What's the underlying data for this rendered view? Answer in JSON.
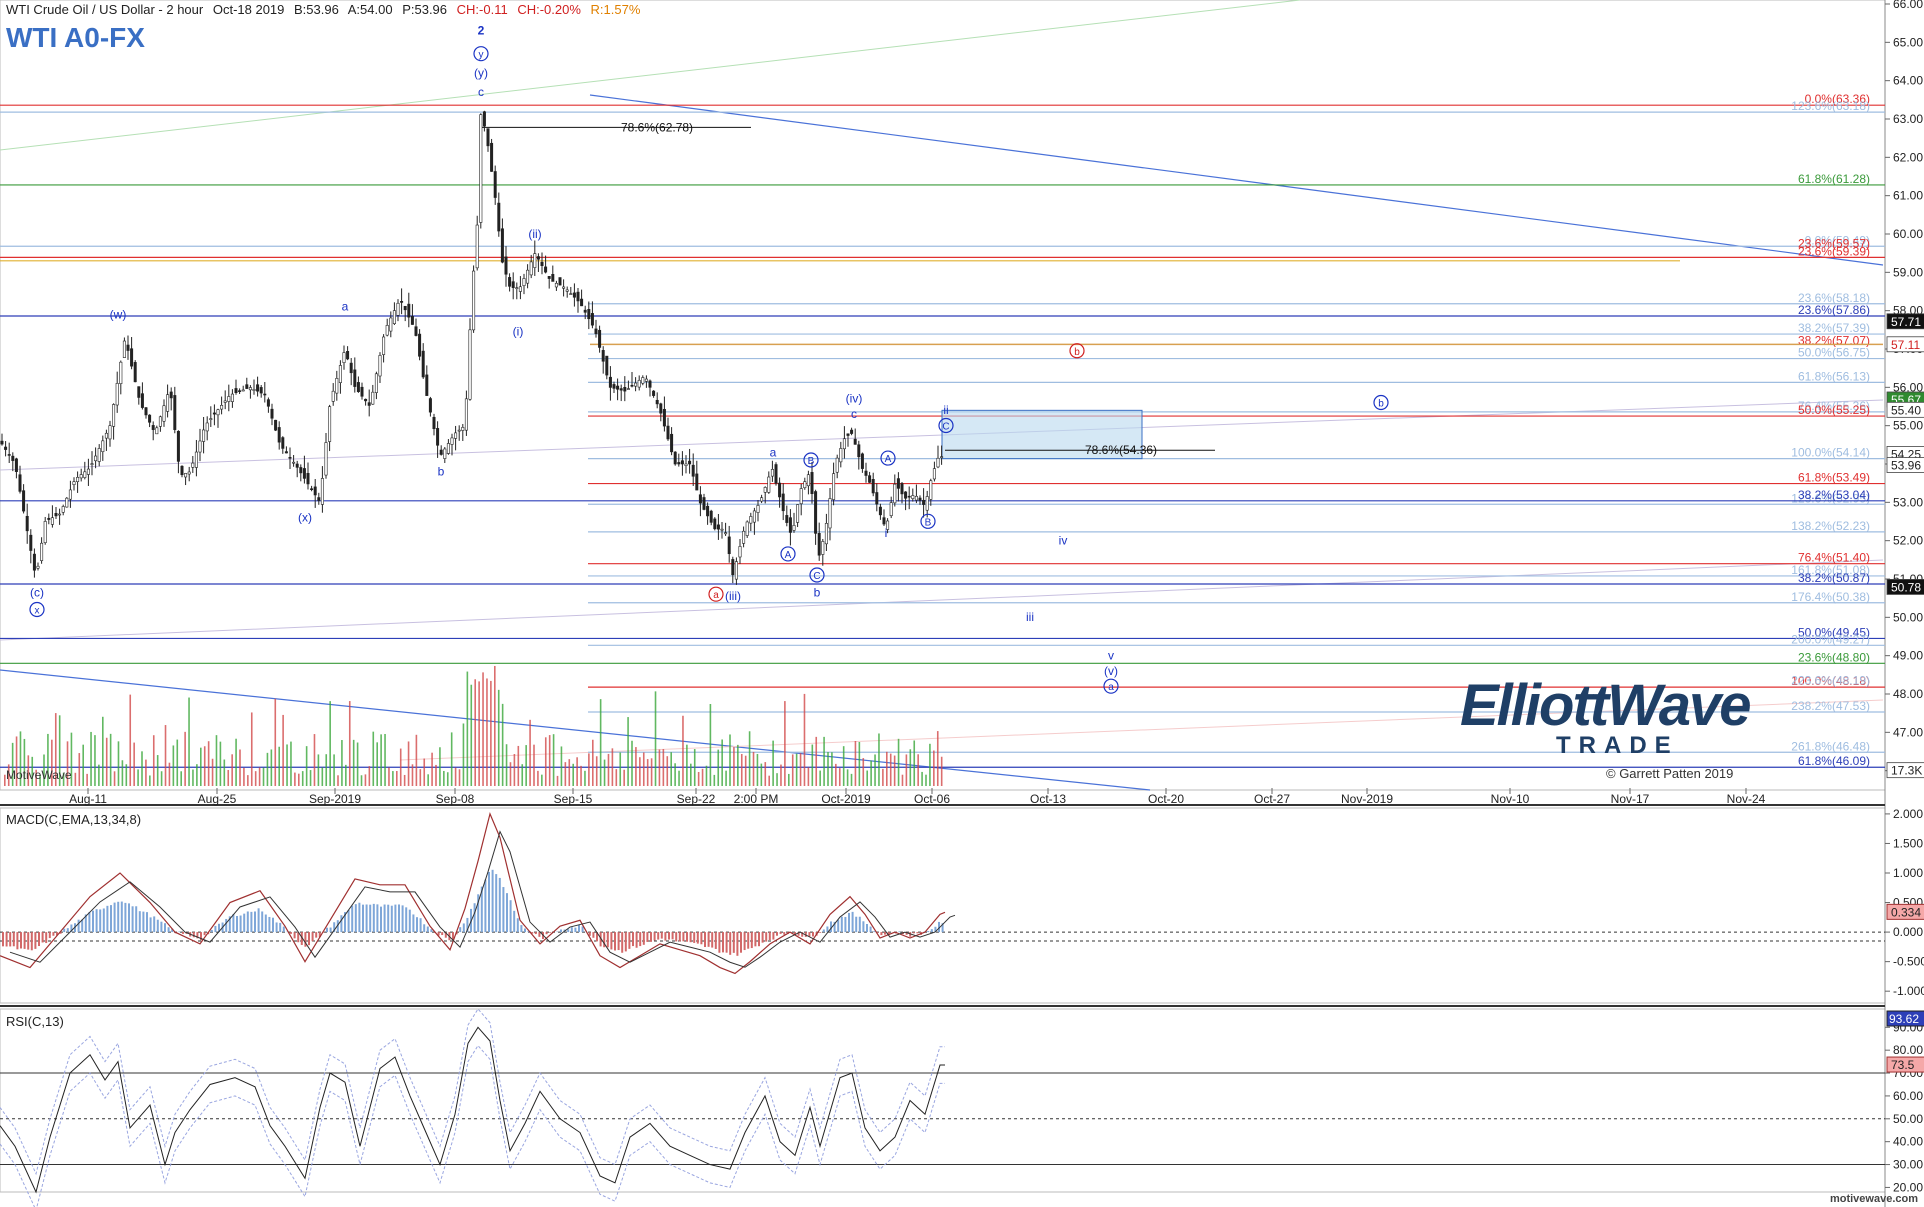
{
  "header": {
    "title": "WTI Crude Oil / US Dollar - 2 hour",
    "date": "Oct-18 2019",
    "bid": "B:53.96",
    "ask": "A:54.00",
    "price": "P:53.96",
    "change": "CH:-0.11",
    "change_pct": "CH:-0.20%",
    "range": "R:1.57%"
  },
  "symbol": "WTI A0-FX",
  "watermark": "MotiveWave",
  "credit": "© Garrett Patten 2019",
  "logo": {
    "top": "ElliottWave",
    "bottom": "TRADE"
  },
  "brand": "motivewave.com",
  "colors": {
    "bull": "#3aa63a",
    "bear": "#d24a4a",
    "fib_red": "#e03030",
    "fib_green": "#3a9a3a",
    "fib_blue": "#2d3fb8",
    "fib_light": "#9fbde0",
    "label_blue": "#1a33c4",
    "label_red": "#d02020",
    "zone": "#b9d9ee"
  },
  "chart_data": [
    {
      "type": "candlestick",
      "pane": "price",
      "ylim": [
        45.6,
        66.0
      ],
      "y_ticks": [
        "46.00",
        "47.00",
        "48.00",
        "49.00",
        "50.00",
        "51.00",
        "52.00",
        "53.00",
        "54.00",
        "55.00",
        "56.00",
        "57.00",
        "58.00",
        "59.00",
        "60.00",
        "61.00",
        "62.00",
        "63.00",
        "64.00",
        "65.00",
        "66.00"
      ],
      "x_ticks": [
        "Aug-11",
        "Aug-25",
        "Sep-2019",
        "Sep-08",
        "Sep-15",
        "Sep-22",
        "2:00 PM",
        "Oct-2019",
        "Oct-06",
        "Oct-13",
        "Oct-20",
        "Oct-27",
        "Nov-2019",
        "Nov-10",
        "Nov-17",
        "Nov-24"
      ],
      "price_path": [
        [
          0,
          54.6
        ],
        [
          15,
          54.0
        ],
        [
          36,
          51.0
        ],
        [
          45,
          52.5
        ],
        [
          60,
          52.7
        ],
        [
          75,
          53.6
        ],
        [
          90,
          53.9
        ],
        [
          110,
          55.0
        ],
        [
          125,
          57.3
        ],
        [
          140,
          55.6
        ],
        [
          155,
          54.8
        ],
        [
          170,
          56.0
        ],
        [
          180,
          53.7
        ],
        [
          190,
          53.8
        ],
        [
          205,
          55.0
        ],
        [
          230,
          55.8
        ],
        [
          250,
          56.0
        ],
        [
          265,
          55.8
        ],
        [
          280,
          54.5
        ],
        [
          295,
          54.0
        ],
        [
          305,
          53.6
        ],
        [
          320,
          53.0
        ],
        [
          330,
          55.6
        ],
        [
          345,
          57.0
        ],
        [
          355,
          56.0
        ],
        [
          370,
          55.5
        ],
        [
          385,
          57.5
        ],
        [
          400,
          58.3
        ],
        [
          415,
          57.5
        ],
        [
          425,
          56.0
        ],
        [
          440,
          54.2
        ],
        [
          455,
          54.8
        ],
        [
          465,
          55.0
        ],
        [
          472,
          58.5
        ],
        [
          478,
          60.5
        ],
        [
          481,
          63.3
        ],
        [
          488,
          62.3
        ],
        [
          495,
          61.0
        ],
        [
          502,
          59.3
        ],
        [
          510,
          58.6
        ],
        [
          520,
          58.6
        ],
        [
          535,
          59.5
        ],
        [
          550,
          58.8
        ],
        [
          565,
          58.6
        ],
        [
          580,
          58.2
        ],
        [
          595,
          57.5
        ],
        [
          610,
          56.0
        ],
        [
          625,
          55.9
        ],
        [
          645,
          56.3
        ],
        [
          660,
          55.4
        ],
        [
          675,
          54.0
        ],
        [
          690,
          54.0
        ],
        [
          700,
          53.0
        ],
        [
          715,
          52.3
        ],
        [
          725,
          52.3
        ],
        [
          733,
          51.08
        ],
        [
          745,
          52.4
        ],
        [
          760,
          53.0
        ],
        [
          772,
          53.9
        ],
        [
          785,
          52.6
        ],
        [
          792,
          52.1
        ],
        [
          800,
          53.3
        ],
        [
          810,
          53.8
        ],
        [
          818,
          51.5
        ],
        [
          825,
          52.2
        ],
        [
          835,
          54.0
        ],
        [
          845,
          54.7
        ],
        [
          852,
          54.8
        ],
        [
          862,
          53.9
        ],
        [
          870,
          53.5
        ],
        [
          880,
          52.7
        ],
        [
          886,
          52.3
        ],
        [
          895,
          53.5
        ],
        [
          905,
          53.1
        ],
        [
          915,
          53.2
        ],
        [
          925,
          52.9
        ],
        [
          932,
          53.7
        ],
        [
          940,
          54.3
        ],
        [
          945,
          53.96
        ]
      ],
      "volume_bars": 240
    },
    {
      "type": "line",
      "pane": "macd",
      "title": "MACD(C,EMA,13,34,8)",
      "ylim": [
        -1.2,
        2.1
      ],
      "y_ticks": [
        "2.000",
        "1.500",
        "1.000",
        "0.500",
        "0.000",
        "-0.500",
        "-1.000"
      ],
      "last_value": "0.334",
      "macd_path": [
        [
          0,
          -0.4
        ],
        [
          30,
          -0.6
        ],
        [
          60,
          0.0
        ],
        [
          90,
          0.6
        ],
        [
          120,
          1.0
        ],
        [
          150,
          0.5
        ],
        [
          175,
          0.0
        ],
        [
          200,
          -0.2
        ],
        [
          230,
          0.5
        ],
        [
          260,
          0.7
        ],
        [
          285,
          0.1
        ],
        [
          305,
          -0.5
        ],
        [
          330,
          0.2
        ],
        [
          355,
          0.9
        ],
        [
          380,
          0.8
        ],
        [
          405,
          0.8
        ],
        [
          430,
          0.1
        ],
        [
          450,
          -0.3
        ],
        [
          465,
          0.4
        ],
        [
          478,
          1.2
        ],
        [
          490,
          2.0
        ],
        [
          500,
          1.6
        ],
        [
          510,
          0.9
        ],
        [
          520,
          0.2
        ],
        [
          540,
          -0.2
        ],
        [
          560,
          0.1
        ],
        [
          580,
          0.2
        ],
        [
          600,
          -0.4
        ],
        [
          620,
          -0.6
        ],
        [
          640,
          -0.4
        ],
        [
          660,
          -0.2
        ],
        [
          680,
          -0.3
        ],
        [
          700,
          -0.4
        ],
        [
          720,
          -0.6
        ],
        [
          735,
          -0.7
        ],
        [
          750,
          -0.5
        ],
        [
          770,
          -0.2
        ],
        [
          790,
          0.0
        ],
        [
          810,
          -0.2
        ],
        [
          830,
          0.3
        ],
        [
          850,
          0.6
        ],
        [
          865,
          0.3
        ],
        [
          880,
          -0.1
        ],
        [
          895,
          0.0
        ],
        [
          910,
          -0.1
        ],
        [
          925,
          0.0
        ],
        [
          940,
          0.3
        ],
        [
          945,
          0.334
        ]
      ]
    },
    {
      "type": "line",
      "pane": "rsi",
      "title": "RSI(C,13)",
      "ylim": [
        18,
        98
      ],
      "y_ticks": [
        "90.00",
        "80.00",
        "70.00",
        "60.00",
        "50.00",
        "40.00",
        "30.00",
        "20.00"
      ],
      "last_values": [
        "93.62",
        "73.5"
      ],
      "rsi_path": [
        [
          0,
          47
        ],
        [
          15,
          38
        ],
        [
          36,
          18
        ],
        [
          50,
          42
        ],
        [
          70,
          70
        ],
        [
          90,
          78
        ],
        [
          105,
          67
        ],
        [
          118,
          75
        ],
        [
          130,
          46
        ],
        [
          150,
          56
        ],
        [
          165,
          30
        ],
        [
          175,
          44
        ],
        [
          190,
          54
        ],
        [
          210,
          65
        ],
        [
          235,
          68
        ],
        [
          255,
          64
        ],
        [
          270,
          47
        ],
        [
          285,
          38
        ],
        [
          305,
          24
        ],
        [
          320,
          55
        ],
        [
          330,
          70
        ],
        [
          345,
          66
        ],
        [
          360,
          38
        ],
        [
          380,
          72
        ],
        [
          395,
          77
        ],
        [
          410,
          60
        ],
        [
          425,
          45
        ],
        [
          440,
          30
        ],
        [
          455,
          52
        ],
        [
          468,
          83
        ],
        [
          478,
          90
        ],
        [
          490,
          84
        ],
        [
          500,
          58
        ],
        [
          510,
          36
        ],
        [
          525,
          48
        ],
        [
          540,
          62
        ],
        [
          560,
          50
        ],
        [
          580,
          44
        ],
        [
          600,
          25
        ],
        [
          615,
          22
        ],
        [
          630,
          42
        ],
        [
          650,
          48
        ],
        [
          670,
          38
        ],
        [
          690,
          34
        ],
        [
          710,
          30
        ],
        [
          730,
          28
        ],
        [
          745,
          44
        ],
        [
          765,
          60
        ],
        [
          780,
          40
        ],
        [
          795,
          34
        ],
        [
          810,
          55
        ],
        [
          820,
          38
        ],
        [
          840,
          68
        ],
        [
          852,
          70
        ],
        [
          865,
          46
        ],
        [
          880,
          36
        ],
        [
          895,
          42
        ],
        [
          910,
          58
        ],
        [
          925,
          52
        ],
        [
          940,
          73.5
        ],
        [
          945,
          73.5
        ]
      ]
    }
  ],
  "price_axis_labels": [
    {
      "text": "57.71",
      "price": 57.71,
      "style": "dark"
    },
    {
      "text": "57.11",
      "price": 57.11,
      "style": "red"
    },
    {
      "text": "55.67",
      "price": 55.67,
      "style": "green"
    },
    {
      "text": "55.40",
      "price": 55.4,
      "style": "light"
    },
    {
      "text": "54.25",
      "price": 54.25,
      "style": "light"
    },
    {
      "text": "53.96",
      "price": 53.96,
      "style": "light"
    },
    {
      "text": "50.78",
      "price": 50.78,
      "style": "dark"
    },
    {
      "text": "17.3K",
      "price": 46.0,
      "style": "light"
    }
  ],
  "fib_levels": [
    {
      "text": "0.0%(63.36)",
      "price": 63.36,
      "color": "fib_red",
      "line": "full"
    },
    {
      "text": "123.6%(63.18)",
      "price": 63.18,
      "color": "fib_light",
      "line": "full"
    },
    {
      "text": "61.8%(61.28)",
      "price": 61.28,
      "color": "fib_green",
      "line": "full"
    },
    {
      "text": "0.0%(59.49)",
      "price": 59.68,
      "color": "fib_light",
      "line": "full"
    },
    {
      "text": "23.6%(59.57)",
      "price": 59.6,
      "color": "fib_red",
      "line": "none"
    },
    {
      "text": "23.6%(59.39)",
      "price": 59.39,
      "color": "fib_red",
      "line": "full"
    },
    {
      "text": "23.6%(58.18)",
      "price": 58.18,
      "color": "fib_light",
      "line": "short"
    },
    {
      "text": "23.6%(57.86)",
      "price": 57.86,
      "color": "fib_blue",
      "line": "full"
    },
    {
      "text": "38.2%(57.39)",
      "price": 57.39,
      "color": "fib_light",
      "line": "short"
    },
    {
      "text": "38.2%(57.07)",
      "price": 57.07,
      "color": "fib_red",
      "line": "none"
    },
    {
      "text": "50.0%(56.75)",
      "price": 56.75,
      "color": "fib_light",
      "line": "short"
    },
    {
      "text": "61.8%(56.13)",
      "price": 56.13,
      "color": "fib_light",
      "line": "short"
    },
    {
      "text": "76.4%(55.36)",
      "price": 55.36,
      "color": "fib_light",
      "line": "short"
    },
    {
      "text": "50.0%(55.25)",
      "price": 55.25,
      "color": "fib_red",
      "line": "short"
    },
    {
      "text": "100.0%(54.14)",
      "price": 54.14,
      "color": "fib_light",
      "line": "short"
    },
    {
      "text": "61.8%(53.49)",
      "price": 53.49,
      "color": "fib_red",
      "line": "short"
    },
    {
      "text": "123.6%(52.95)",
      "price": 52.95,
      "color": "fib_light",
      "line": "short"
    },
    {
      "text": "38.2%(53.04)",
      "price": 53.04,
      "color": "fib_blue",
      "line": "full"
    },
    {
      "text": "138.2%(52.23)",
      "price": 52.23,
      "color": "fib_light",
      "line": "short"
    },
    {
      "text": "76.4%(51.40)",
      "price": 51.4,
      "color": "fib_red",
      "line": "short"
    },
    {
      "text": "161.8%(51.08)",
      "price": 51.08,
      "color": "fib_light",
      "line": "short"
    },
    {
      "text": "38.2%(50.87)",
      "price": 50.87,
      "color": "fib_blue",
      "line": "full"
    },
    {
      "text": "176.4%(50.38)",
      "price": 50.38,
      "color": "fib_light",
      "line": "short"
    },
    {
      "text": "50.0%(49.45)",
      "price": 49.45,
      "color": "fib_blue",
      "line": "full"
    },
    {
      "text": "200.0%(49.27)",
      "price": 49.27,
      "color": "fib_light",
      "line": "short"
    },
    {
      "text": "23.6%(48.80)",
      "price": 48.8,
      "color": "fib_green",
      "line": "full"
    },
    {
      "text": "100.0%(48.18)",
      "price": 48.18,
      "color": "fib_red",
      "line": "short"
    },
    {
      "text": "223.6%(48.19)",
      "price": 48.19,
      "color": "fib_light",
      "line": "none"
    },
    {
      "text": "238.2%(47.53)",
      "price": 47.53,
      "color": "fib_light",
      "line": "short"
    },
    {
      "text": "261.8%(46.48)",
      "price": 46.48,
      "color": "fib_light",
      "line": "short"
    },
    {
      "text": "61.8%(46.09)",
      "price": 46.09,
      "color": "fib_blue",
      "line": "full"
    }
  ],
  "inline_fibs": [
    {
      "text": "78.6%(62.78)",
      "price": 62.78,
      "x0": 481
    },
    {
      "text": "78.6%(54.36)",
      "price": 54.36,
      "x0": 945
    }
  ],
  "wave_labels": [
    {
      "text": "2",
      "x": 481,
      "price": 65.2,
      "color": "label_blue",
      "bold": true
    },
    {
      "text": "y",
      "x": 481,
      "price": 64.6,
      "color": "label_blue",
      "circle": true
    },
    {
      "text": "(y)",
      "x": 481,
      "price": 64.1,
      "color": "label_blue"
    },
    {
      "text": "c",
      "x": 481,
      "price": 63.6,
      "color": "label_blue"
    },
    {
      "text": "(w)",
      "x": 118,
      "price": 57.8,
      "color": "label_blue"
    },
    {
      "text": "a",
      "x": 345,
      "price": 58.0,
      "color": "label_blue"
    },
    {
      "text": "b",
      "x": 441,
      "price": 53.7,
      "color": "label_blue"
    },
    {
      "text": "(x)",
      "x": 305,
      "price": 52.5,
      "color": "label_blue"
    },
    {
      "text": "(c)",
      "x": 37,
      "price": 50.55,
      "color": "label_blue"
    },
    {
      "text": "x",
      "x": 37,
      "price": 50.1,
      "color": "label_blue",
      "circle": true
    },
    {
      "text": "(ii)",
      "x": 535,
      "price": 59.9,
      "color": "label_blue"
    },
    {
      "text": "(i)",
      "x": 518,
      "price": 57.35,
      "color": "label_blue"
    },
    {
      "text": "(iii)",
      "x": 733,
      "price": 50.45,
      "color": "label_blue"
    },
    {
      "text": "a",
      "x": 716,
      "price": 50.5,
      "color": "label_red",
      "circle": true
    },
    {
      "text": "a",
      "x": 773,
      "price": 54.2,
      "color": "label_blue"
    },
    {
      "text": "A",
      "x": 788,
      "price": 51.55,
      "color": "label_blue",
      "circle": true
    },
    {
      "text": "B",
      "x": 811,
      "price": 54.0,
      "color": "label_blue",
      "circle": true
    },
    {
      "text": "C",
      "x": 817,
      "price": 51.0,
      "color": "label_blue",
      "circle": true
    },
    {
      "text": "b",
      "x": 817,
      "price": 50.55,
      "color": "label_blue"
    },
    {
      "text": "(iv)",
      "x": 854,
      "price": 55.6,
      "color": "label_blue"
    },
    {
      "text": "c",
      "x": 854,
      "price": 55.2,
      "color": "label_blue"
    },
    {
      "text": "A",
      "x": 888,
      "price": 54.05,
      "color": "label_blue",
      "circle": true
    },
    {
      "text": "i",
      "x": 886,
      "price": 52.1,
      "color": "label_blue"
    },
    {
      "text": "B",
      "x": 928,
      "price": 52.4,
      "color": "label_blue",
      "circle": true
    },
    {
      "text": "ii",
      "x": 946,
      "price": 55.3,
      "color": "label_blue"
    },
    {
      "text": "C",
      "x": 946,
      "price": 54.9,
      "color": "label_blue",
      "circle": true
    },
    {
      "text": "b",
      "x": 1077,
      "price": 56.85,
      "color": "label_red",
      "circle": true
    },
    {
      "text": "b",
      "x": 1381,
      "price": 55.5,
      "color": "label_blue",
      "circle": true
    },
    {
      "text": "iv",
      "x": 1063,
      "price": 51.9,
      "color": "label_blue"
    },
    {
      "text": "iii",
      "x": 1030,
      "price": 49.9,
      "color": "label_blue"
    },
    {
      "text": "v",
      "x": 1111,
      "price": 48.9,
      "color": "label_blue"
    },
    {
      "text": "(v)",
      "x": 1111,
      "price": 48.5,
      "color": "label_blue"
    },
    {
      "text": "a",
      "x": 1111,
      "price": 48.1,
      "color": "label_blue",
      "circle": true
    }
  ]
}
